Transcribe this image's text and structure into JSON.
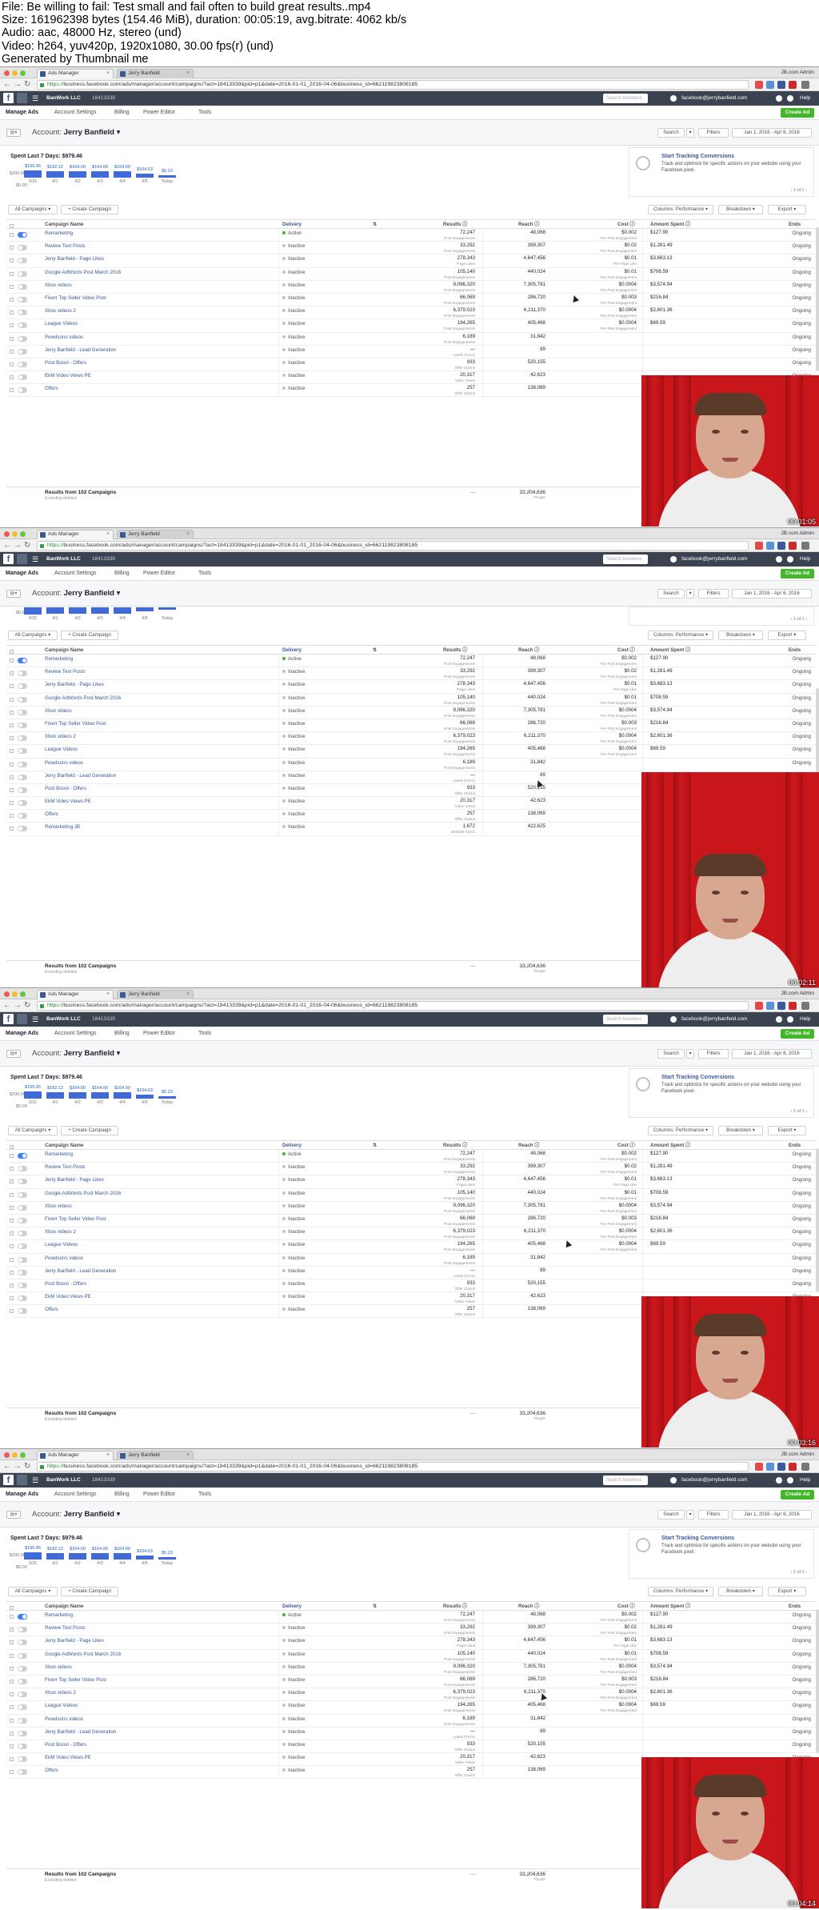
{
  "header": {
    "file": "File: Be willing to fail: Test small and fail often to build great results..mp4",
    "size": "Size: 161962398 bytes (154.46 MiB), duration: 00:05:19, avg.bitrate: 4062 kb/s",
    "audio": "Audio: aac, 48000 Hz, stereo (und)",
    "video": "Video: h264, yuv420p, 1920x1080, 30.00 fps(r) (und)",
    "generated": "Generated by Thumbnail me"
  },
  "browser": {
    "tab1": "Ads Manager",
    "tab2": "Jerry Banfield",
    "profile": "JB.com Admin",
    "url_scheme": "https://",
    "url_rest": "business.facebook.com/ads/manager/account/campaigns/?act=18413339&pid=p1&date=2016-01-01_2016-04-06&business_id=662119823808185"
  },
  "fb": {
    "business": "BanWork LLC",
    "account_id": "18413339",
    "search_placeholder": "Search business",
    "user": "facebook@jerrybanfield.com",
    "help": "Help"
  },
  "subnav": {
    "manage_ads": "Manage Ads",
    "account_settings": "Account Settings",
    "billing": "Billing",
    "power_editor": "Power Editor",
    "tools": "Tools",
    "create_ad": "Create Ad"
  },
  "account": {
    "label": "Account:",
    "name": "Jerry Banfield",
    "search": "Search",
    "filters": "Filters",
    "date_range": "Jan 1, 2016 - Apr 6, 2016"
  },
  "spend": {
    "title": "Spent Last 7 Days: $979.46",
    "y_top": "$200.00",
    "y_bottom": "$0.00",
    "bars": [
      {
        "label": "$195.95",
        "date": "3/31",
        "value": 195.95
      },
      {
        "label": "$182.12",
        "date": "4/1",
        "value": 182.12
      },
      {
        "label": "$164.00",
        "date": "4/2",
        "value": 164.0
      },
      {
        "label": "$164.00",
        "date": "4/3",
        "value": 164.0
      },
      {
        "label": "$164.00",
        "date": "4/4",
        "value": 164.0
      },
      {
        "label": "$104.63",
        "date": "4/5",
        "value": 104.63
      },
      {
        "label": "$5.23",
        "date": "Today",
        "value": 5.23
      }
    ]
  },
  "tracking": {
    "title": "Start Tracking Conversions",
    "text": "Track and optimize for specific actions on your website using your Facebook pixel.",
    "page": "1 of 1"
  },
  "toolbar": {
    "all_campaigns": "All Campaigns",
    "create_campaign": "+ Create Campaign",
    "columns": "Columns: Performance",
    "breakdown": "Breakdown",
    "export": "Export"
  },
  "columns": {
    "name": "Campaign Name",
    "delivery": "Delivery",
    "results": "Results",
    "reach": "Reach",
    "cost": "Cost",
    "amount": "Amount Spent",
    "ends": "Ends"
  },
  "campaigns": [
    {
      "name": "Remarketing",
      "delivery": "Active",
      "results": "72,247",
      "results_sub": "Post Engagements",
      "reach": "48,068",
      "cost": "$0.002",
      "cost_sub": "Per Post Engagement",
      "amount": "$127.90",
      "ends": "Ongoing"
    },
    {
      "name": "Review Text Posts",
      "delivery": "Inactive",
      "results": "33,292",
      "results_sub": "Post Engagements",
      "reach": "399,307",
      "cost": "$0.02",
      "cost_sub": "Per Post Engagement",
      "amount": "$1,281.49",
      "ends": "Ongoing"
    },
    {
      "name": "Jerry Banfield - Page Likes",
      "delivery": "Inactive",
      "results": "278,343",
      "results_sub": "Page Likes",
      "reach": "4,647,456",
      "cost": "$0.01",
      "cost_sub": "Per Page Like",
      "amount": "$3,683.13",
      "ends": "Ongoing"
    },
    {
      "name": "Google AdWords Post March 2016",
      "delivery": "Inactive",
      "results": "105,140",
      "results_sub": "Post Engagements",
      "reach": "440,024",
      "cost": "$0.01",
      "cost_sub": "Per Post Engagement",
      "amount": "$708.59",
      "ends": "Ongoing"
    },
    {
      "name": "Xbox videos",
      "delivery": "Inactive",
      "results": "9,096,320",
      "results_sub": "Post Engagements",
      "reach": "7,305,781",
      "cost": "$0.0004",
      "cost_sub": "Per Post Engagement",
      "amount": "$3,574.94",
      "ends": "Ongoing"
    },
    {
      "name": "Fiverr Top Seller Video Post",
      "delivery": "Inactive",
      "results": "66,069",
      "results_sub": "Post Engagements",
      "reach": "286,720",
      "cost": "$0.003",
      "cost_sub": "Per Post Engagement",
      "amount": "$216.84",
      "ends": "Ongoing"
    },
    {
      "name": "Xbox videos 2",
      "delivery": "Inactive",
      "results": "6,379,023",
      "results_sub": "Post Engagements",
      "reach": "6,211,370",
      "cost": "$0.0004",
      "cost_sub": "Per Post Engagement",
      "amount": "$2,601.36",
      "ends": "Ongoing"
    },
    {
      "name": "League Videos",
      "delivery": "Inactive",
      "results": "194,265",
      "results_sub": "Post Engagements",
      "reach": "405,468",
      "cost": "$0.0004",
      "cost_sub": "Per Post Engagement",
      "amount": "$69.59",
      "ends": "Ongoing"
    },
    {
      "name": "Pewdsons videos",
      "delivery": "Inactive",
      "results": "6,189",
      "results_sub": "Post Engagements",
      "reach": "31,842",
      "cost": "",
      "cost_sub": "",
      "amount": "",
      "ends": "Ongoing"
    },
    {
      "name": "Jerry Banfield - Lead Generation",
      "delivery": "Inactive",
      "results": "—",
      "results_sub": "Leads (Form)",
      "reach": "89",
      "cost": "",
      "cost_sub": "",
      "amount": "",
      "ends": "Ongoing"
    },
    {
      "name": "Post Boost - Offers",
      "delivery": "Inactive",
      "results": "933",
      "results_sub": "Offer Claims",
      "reach": "520,155",
      "cost": "",
      "cost_sub": "",
      "amount": "",
      "ends": "Ongoing"
    },
    {
      "name": "EkM Video Views PE",
      "delivery": "Inactive",
      "results": "20,317",
      "results_sub": "Video Views",
      "reach": "42,623",
      "cost": "",
      "cost_sub": "",
      "amount": "",
      "ends": "Ongoing"
    },
    {
      "name": "Offers",
      "delivery": "Inactive",
      "results": "257",
      "results_sub": "Offer Claims",
      "reach": "138,069",
      "cost": "",
      "cost_sub": "",
      "amount": "",
      "ends": "Ongoing"
    },
    {
      "name": "Remarketing JB",
      "delivery": "Inactive",
      "results": "1,672",
      "results_sub": "Website Clicks",
      "reach": "422,625",
      "cost": "",
      "cost_sub": "",
      "amount": "",
      "ends": "Ongoing"
    }
  ],
  "footer": {
    "results": "Results from 102 Campaigns",
    "excluding": "Excluding deleted",
    "dash": "—",
    "total_reach": "33,204,636",
    "total_sub": "People"
  },
  "timestamps": [
    "00:01:05",
    "00:02:11",
    "00:03:16",
    "00:04:14"
  ],
  "colors": {
    "fb_dark": "#3b4350",
    "accent_blue": "#4080ff",
    "green": "#42b72a",
    "bar_blue": "#3f6ad8",
    "curtain_red": "#c8161b"
  }
}
